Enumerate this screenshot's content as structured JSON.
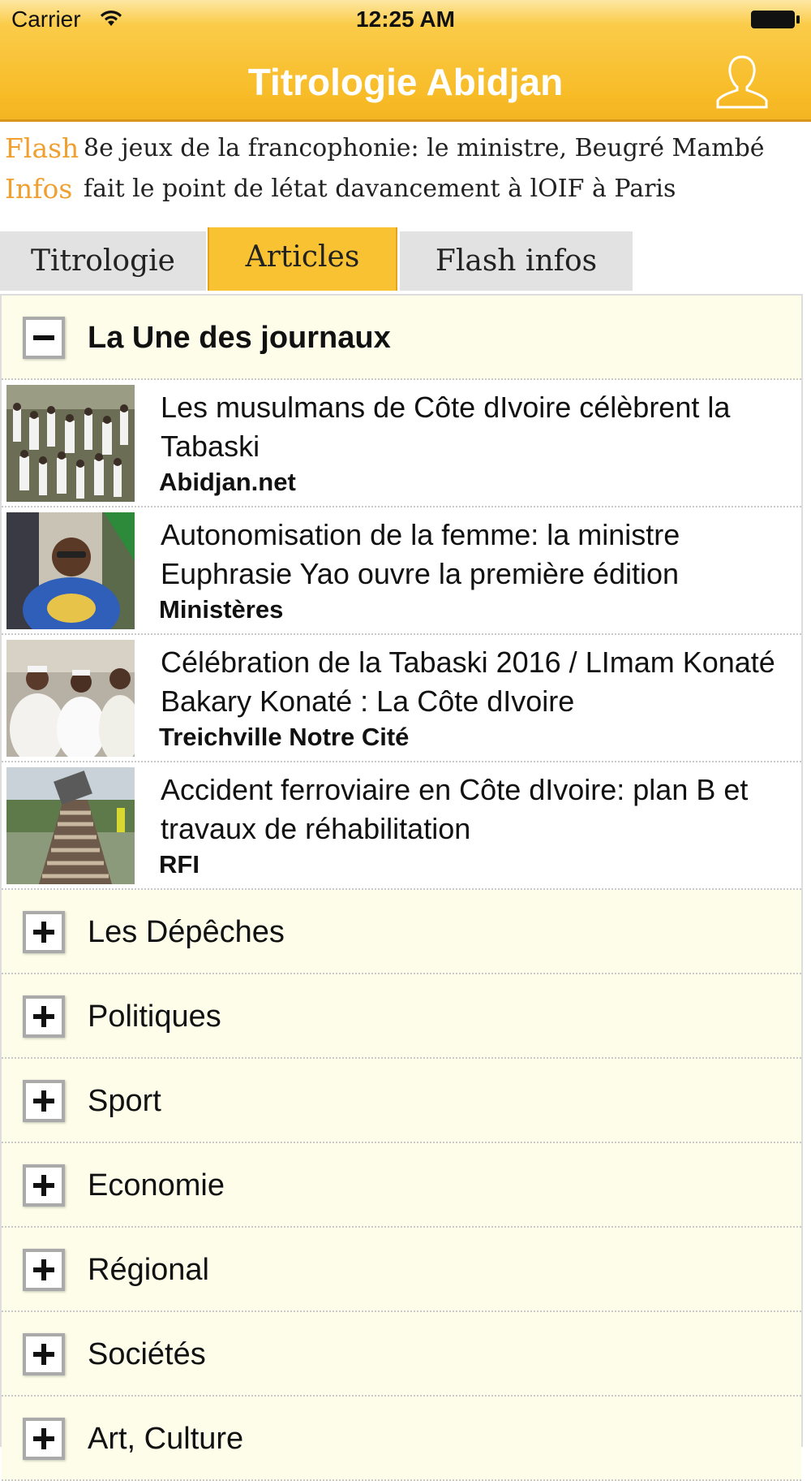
{
  "status_bar": {
    "carrier": "Carrier",
    "time": "12:25 AM"
  },
  "header": {
    "title": "Titrologie Abidjan"
  },
  "flash": {
    "label_line1": "Flash",
    "label_line2": "Infos",
    "text": "8e jeux de la francophonie: le ministre, Beugré Mambé fait le point de létat davancement à lOIF à Paris"
  },
  "tabs": [
    {
      "label": "Titrologie",
      "active": false
    },
    {
      "label": "Articles",
      "active": true
    },
    {
      "label": "Flash infos",
      "active": false
    }
  ],
  "open_section": {
    "label": "La Une des journaux",
    "articles": [
      {
        "title": "Les musulmans de Côte dIvoire célèbrent la Tabaski",
        "source": "Abidjan.net"
      },
      {
        "title": "Autonomisation de la femme: la ministre Euphrasie Yao ouvre la première édition",
        "source": "Ministères"
      },
      {
        "title": "Célébration de la Tabaski 2016 / LImam Konaté Bakary Konaté :  La Côte dIvoire",
        "source": "Treichville Notre Cité"
      },
      {
        "title": "Accident ferroviaire en Côte dIvoire: plan B et travaux de réhabilitation",
        "source": "RFI"
      }
    ]
  },
  "collapsed_sections": [
    "Les Dépêches",
    "Politiques",
    "Sport",
    "Economie",
    "Régional",
    "Sociétés",
    "Art, Culture"
  ],
  "colors": {
    "header": "#f7bb26",
    "accent": "#f0a030",
    "active_tab": "#f8c232",
    "section_bg": "#fdfdea"
  }
}
